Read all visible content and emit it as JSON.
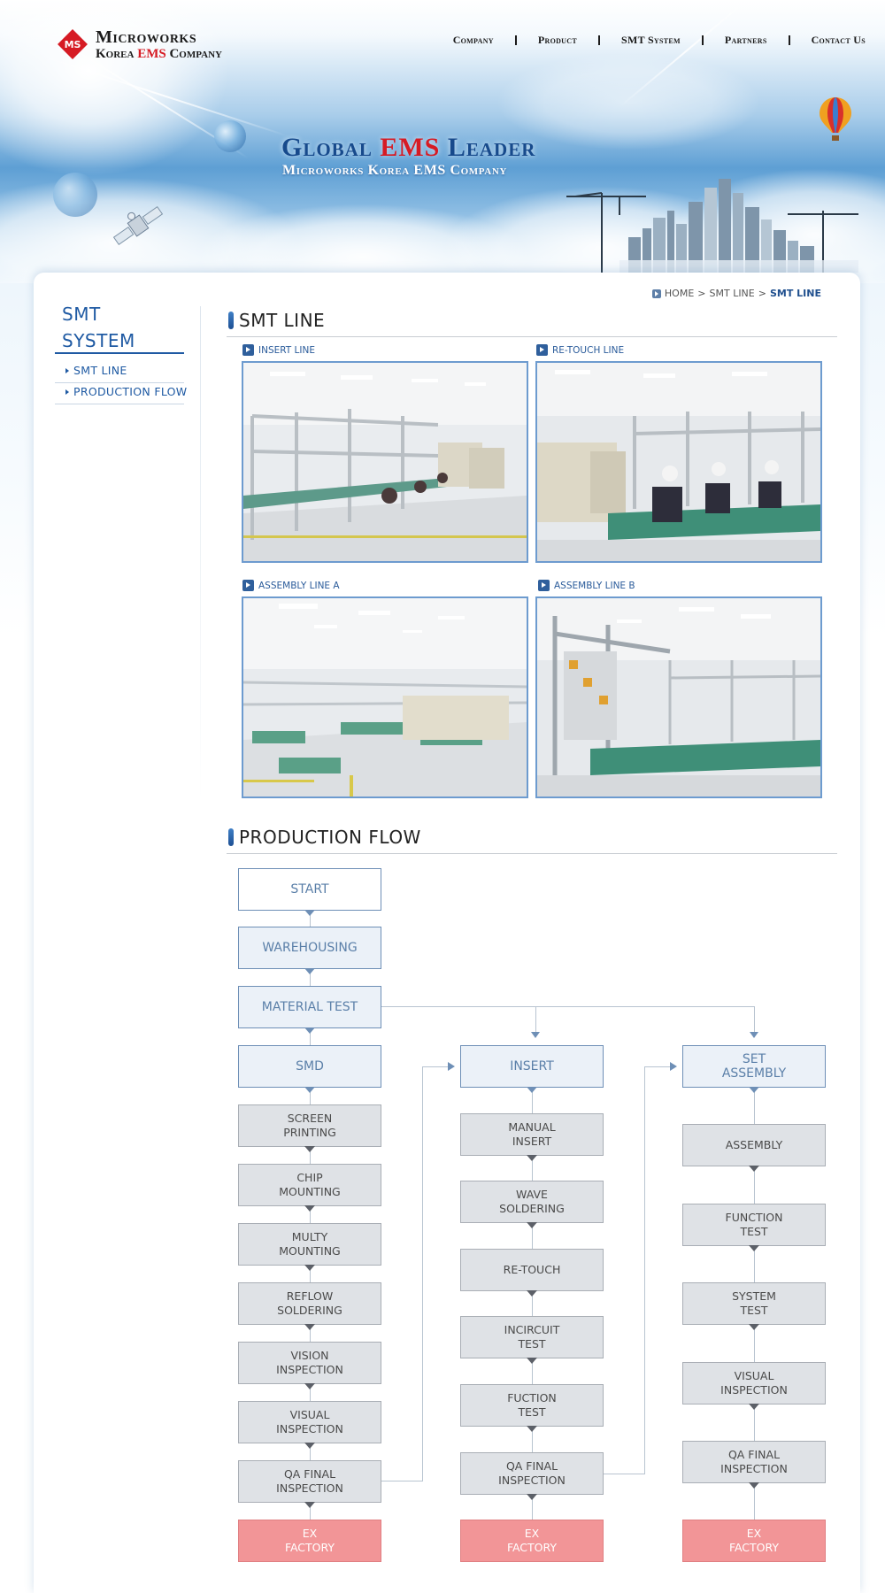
{
  "header": {
    "logo_name": "Microworks",
    "logo_sub_prefix": "Korea",
    "logo_sub_accent": "EMS",
    "logo_sub_suffix": "Company",
    "nav": [
      "Company",
      "Product",
      "SMT System",
      "Partners",
      "Contact Us"
    ],
    "hero_title_prefix": "Global",
    "hero_title_accent": "EMS",
    "hero_title_suffix": "Leader",
    "hero_subtitle": "Microworks Korea EMS Company"
  },
  "colors": {
    "brand_blue": "#1f5aa3",
    "accent_red": "#d61b24",
    "ex_factory": "#f29597"
  },
  "sidebar": {
    "title_line1": "SMT",
    "title_line2": "SYSTEM",
    "items": [
      {
        "label": "SMT LINE"
      },
      {
        "label": "PRODUCTION FLOW"
      }
    ]
  },
  "breadcrumb": {
    "home": "HOME",
    "parent": "SMT LINE",
    "current": "SMT LINE"
  },
  "smt_line": {
    "title": "SMT LINE",
    "photos": [
      {
        "caption": "INSERT LINE"
      },
      {
        "caption": "RE-TOUCH LINE"
      },
      {
        "caption": "ASSEMBLY LINE A"
      },
      {
        "caption": "ASSEMBLY LINE B"
      }
    ]
  },
  "production_flow": {
    "title": "PRODUCTION FLOW",
    "start": "START",
    "warehousing": "WAREHOUSING",
    "material_test": "MATERIAL TEST",
    "col1": {
      "head": "SMD",
      "steps": [
        "SCREEN\nPRINTING",
        "CHIP\nMOUNTING",
        "MULTY\nMOUNTING",
        "REFLOW\nSOLDERING",
        "VISION\nINSPECTION",
        "VISUAL\nINSPECTION",
        "QA FINAL\nINSPECTION"
      ],
      "end": "EX\nFACTORY"
    },
    "col2": {
      "head": "INSERT",
      "steps": [
        "MANUAL\nINSERT",
        "WAVE\nSOLDERING",
        "RE-TOUCH",
        "INCIRCUIT\nTEST",
        "FUCTION\nTEST",
        "QA FINAL\nINSPECTION"
      ],
      "end": "EX\nFACTORY"
    },
    "col3": {
      "head": "SET\nASSEMBLY",
      "steps": [
        "ASSEMBLY",
        "FUNCTION\nTEST",
        "SYSTEM\nTEST",
        "VISUAL\nINSPECTION",
        "QA FINAL\nINSPECTION"
      ],
      "end": "EX\nFACTORY"
    }
  }
}
